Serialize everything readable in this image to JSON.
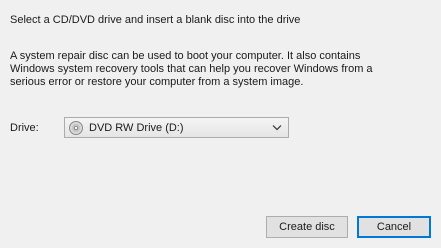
{
  "dialog": {
    "instruction": "Select a CD/DVD drive and insert a blank disc into the drive",
    "description_lines": [
      "A system repair disc can be used to boot your computer. It also contains",
      "Windows system recovery tools that can help you recover Windows from a",
      "serious error or restore your computer from a system image."
    ],
    "drive_label": "Drive:",
    "drive_selected": "DVD RW Drive (D:)",
    "drive_icon": "disc-drive-icon",
    "dropdown_icon": "chevron-down-icon"
  },
  "buttons": {
    "create": "Create disc",
    "cancel": "Cancel"
  },
  "colors": {
    "background": "#f0f0f0",
    "focus_border": "#0078d7"
  }
}
